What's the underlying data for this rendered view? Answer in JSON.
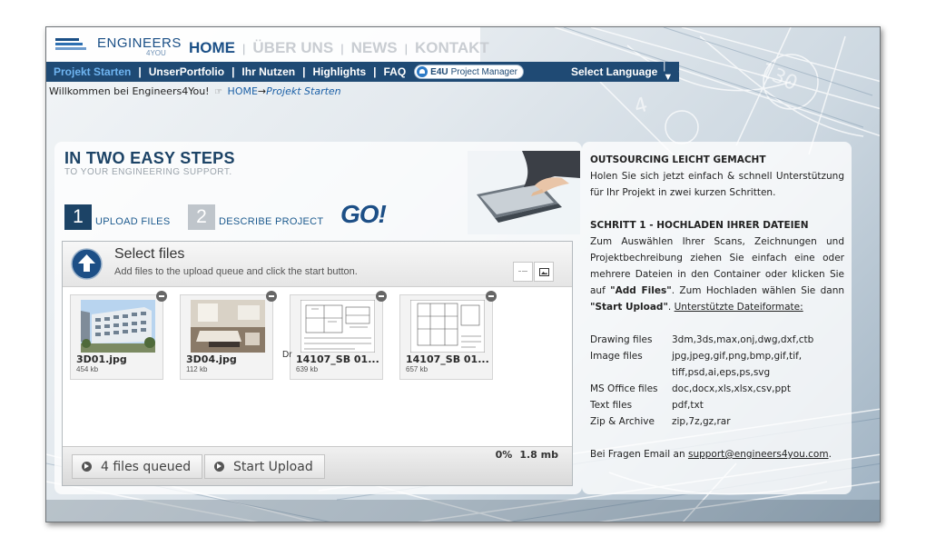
{
  "header": {
    "logo_text": "ENGINEERS",
    "logo_sub": "4YOU",
    "main_nav": [
      {
        "label": "HOME"
      },
      {
        "label": "ÜBER UNS"
      },
      {
        "label": "NEWS"
      },
      {
        "label": "KONTAKT"
      }
    ],
    "main_sep": "|",
    "sub_nav": [
      {
        "label": "Projekt Starten"
      },
      {
        "label": "UnserPortfolio"
      },
      {
        "label": "Ihr Nutzen"
      },
      {
        "label": "Highlights"
      },
      {
        "label": "FAQ"
      }
    ],
    "sub_sep": "|",
    "pm_badge": {
      "bold": "E4U",
      "text": "Project Manager"
    },
    "language_label": "Select Language",
    "language_arrow": "| ▼"
  },
  "breadcrumb": {
    "welcome": "Willkommen bei Engineers4You!",
    "hand": "☞",
    "home": "HOME",
    "arrow": "→",
    "current": "Projekt Starten"
  },
  "steps": {
    "title": "IN TWO EASY STEPS",
    "subtitle": "TO YOUR ENGINEERING SUPPORT.",
    "step1_num": "1",
    "step1_label": "UPLOAD FILES",
    "step2_num": "2",
    "step2_label": "DESCRIBE PROJECT",
    "go": "GO!"
  },
  "uploader": {
    "title": "Select files",
    "description": "Add files to the upload queue and click the start button.",
    "files": [
      {
        "name": "3D01.jpg",
        "size": "454 kb"
      },
      {
        "name": "3D04.jpg",
        "size": "112 kb"
      },
      {
        "name": "14107_SB 01...",
        "size": "639 kb"
      },
      {
        "name": "14107_SB 01...",
        "size": "657 kb"
      }
    ],
    "stray_text": "Dr",
    "queued_label": "4 files queued",
    "start_label": "Start Upload",
    "progress_percent": "0%",
    "total_size": "1.8 mb"
  },
  "info": {
    "h1": "OUTSOURCING LEICHT GEMACHT",
    "p1": "Holen Sie sich jetzt einfach & schnell Unterstützung für Ihr Projekt in zwei kurzen Schritten.",
    "h2": "SCHRITT 1 - HOCHLADEN IHRER DATEIEN",
    "p2_a": "Zum Auswählen Ihrer Scans, Zeichnungen und Projektbechreibung ziehen Sie einfach eine oder mehrere Dateien in den Container oder klicken Sie auf ",
    "p2_b": "\"Add Files\"",
    "p2_c": ". Zum Hochladen wählen Sie dann ",
    "p2_d": "\"Start Upload\"",
    "p2_e": ". ",
    "p2_link": "Unterstützte Dateiformate:",
    "formats": [
      {
        "type": "Drawing files",
        "ext": "3dm,3ds,max,onj,dwg,dxf,ctb"
      },
      {
        "type": "Image files",
        "ext": "jpg,jpeg,gif,png,bmp,gif,tif, tiff,psd,ai,eps,ps,svg"
      },
      {
        "type": "MS Office files",
        "ext": "doc,docx,xls,xlsx,csv,ppt"
      },
      {
        "type": "Text files",
        "ext": "pdf,txt"
      },
      {
        "type": "Zip & Archive",
        "ext": "zip,7z,gz,rar"
      }
    ],
    "contact_text": "Bei Fragen Email an ",
    "contact_email": "support@engineers4you.com",
    "contact_end": "."
  },
  "colors": {
    "nav_bar": "#1f4a74",
    "brand_blue": "#1a4f86",
    "step_active": "#1c4366",
    "step_inactive": "#bfc5cb"
  }
}
